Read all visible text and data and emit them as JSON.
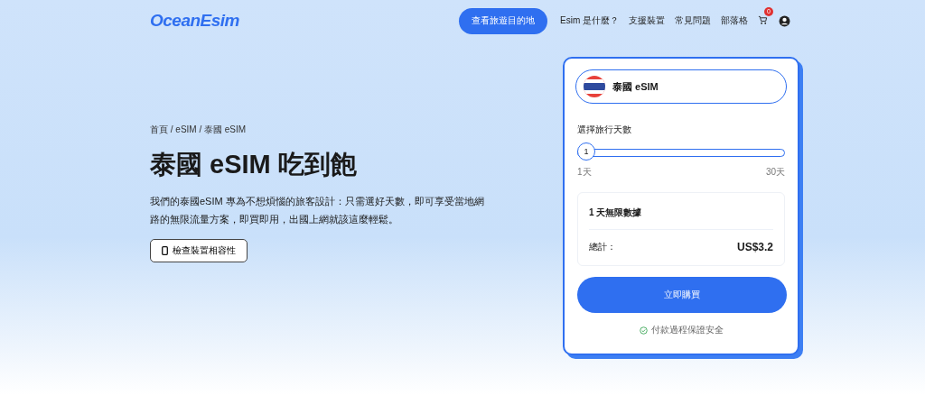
{
  "header": {
    "logo": "OceanEsim",
    "cta": "查看旅遊目的地",
    "nav": [
      "Esim 是什麼？",
      "支援裝置",
      "常見問題",
      "部落格"
    ],
    "cart_count": "0"
  },
  "hero": {
    "breadcrumb": "首頁 / eSIM / 泰國 eSIM",
    "title": "泰國 eSIM 吃到飽",
    "description": "我們的泰國eSIM 專為不想煩惱的旅客設計：只需選好天數，即可享受當地網路的無限流量方案，即買即用，出國上網就該這麼輕鬆。",
    "button": "檢查裝置相容性"
  },
  "order": {
    "country": "泰國 eSIM",
    "days_label": "選擇旅行天數",
    "slider": {
      "value": "1",
      "level": 0,
      "min_label": "1天",
      "max_label": "30天"
    },
    "plan": "1 天無限數據",
    "total_label": "總計：",
    "total": "US$3.2",
    "buy": "立即購買",
    "secure_note": "付款過程保證安全"
  }
}
